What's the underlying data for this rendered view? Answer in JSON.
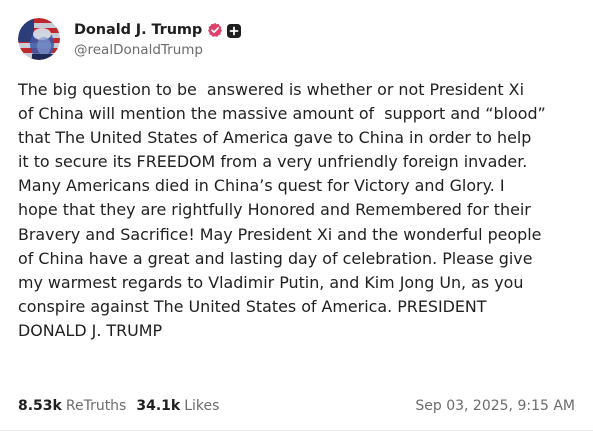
{
  "author": {
    "display_name": "Donald J. Trump",
    "handle": "@realDonaldTrump",
    "verified_icon": "verified-check-icon",
    "plus_icon": "plus-badge-icon",
    "accent_color": "#e0416a"
  },
  "post": {
    "lines": [
      "The big question to be  answered is whether or not President Xi",
      "of China will mention the massive amount of  support and “blood”",
      "that The United States of America gave to China in order to help",
      "it to secure its FREEDOM from a very unfriendly foreign invader.",
      "Many Americans died in China’s quest for Victory and Glory. I",
      "hope that they are rightfully Honored and Remembered for their",
      "Bravery and Sacrifice! May President Xi and the wonderful people",
      "of China have a great and lasting day of celebration. Please give",
      "my warmest regards to Vladimir Putin, and Kim Jong Un, as you",
      "conspire against The United States of America. PRESIDENT",
      "DONALD J. TRUMP"
    ]
  },
  "stats": {
    "retruths_count": "8.53k",
    "retruths_label": "ReTruths",
    "likes_count": "34.1k",
    "likes_label": "Likes"
  },
  "timestamp": "Sep 03, 2025, 9:15 AM"
}
